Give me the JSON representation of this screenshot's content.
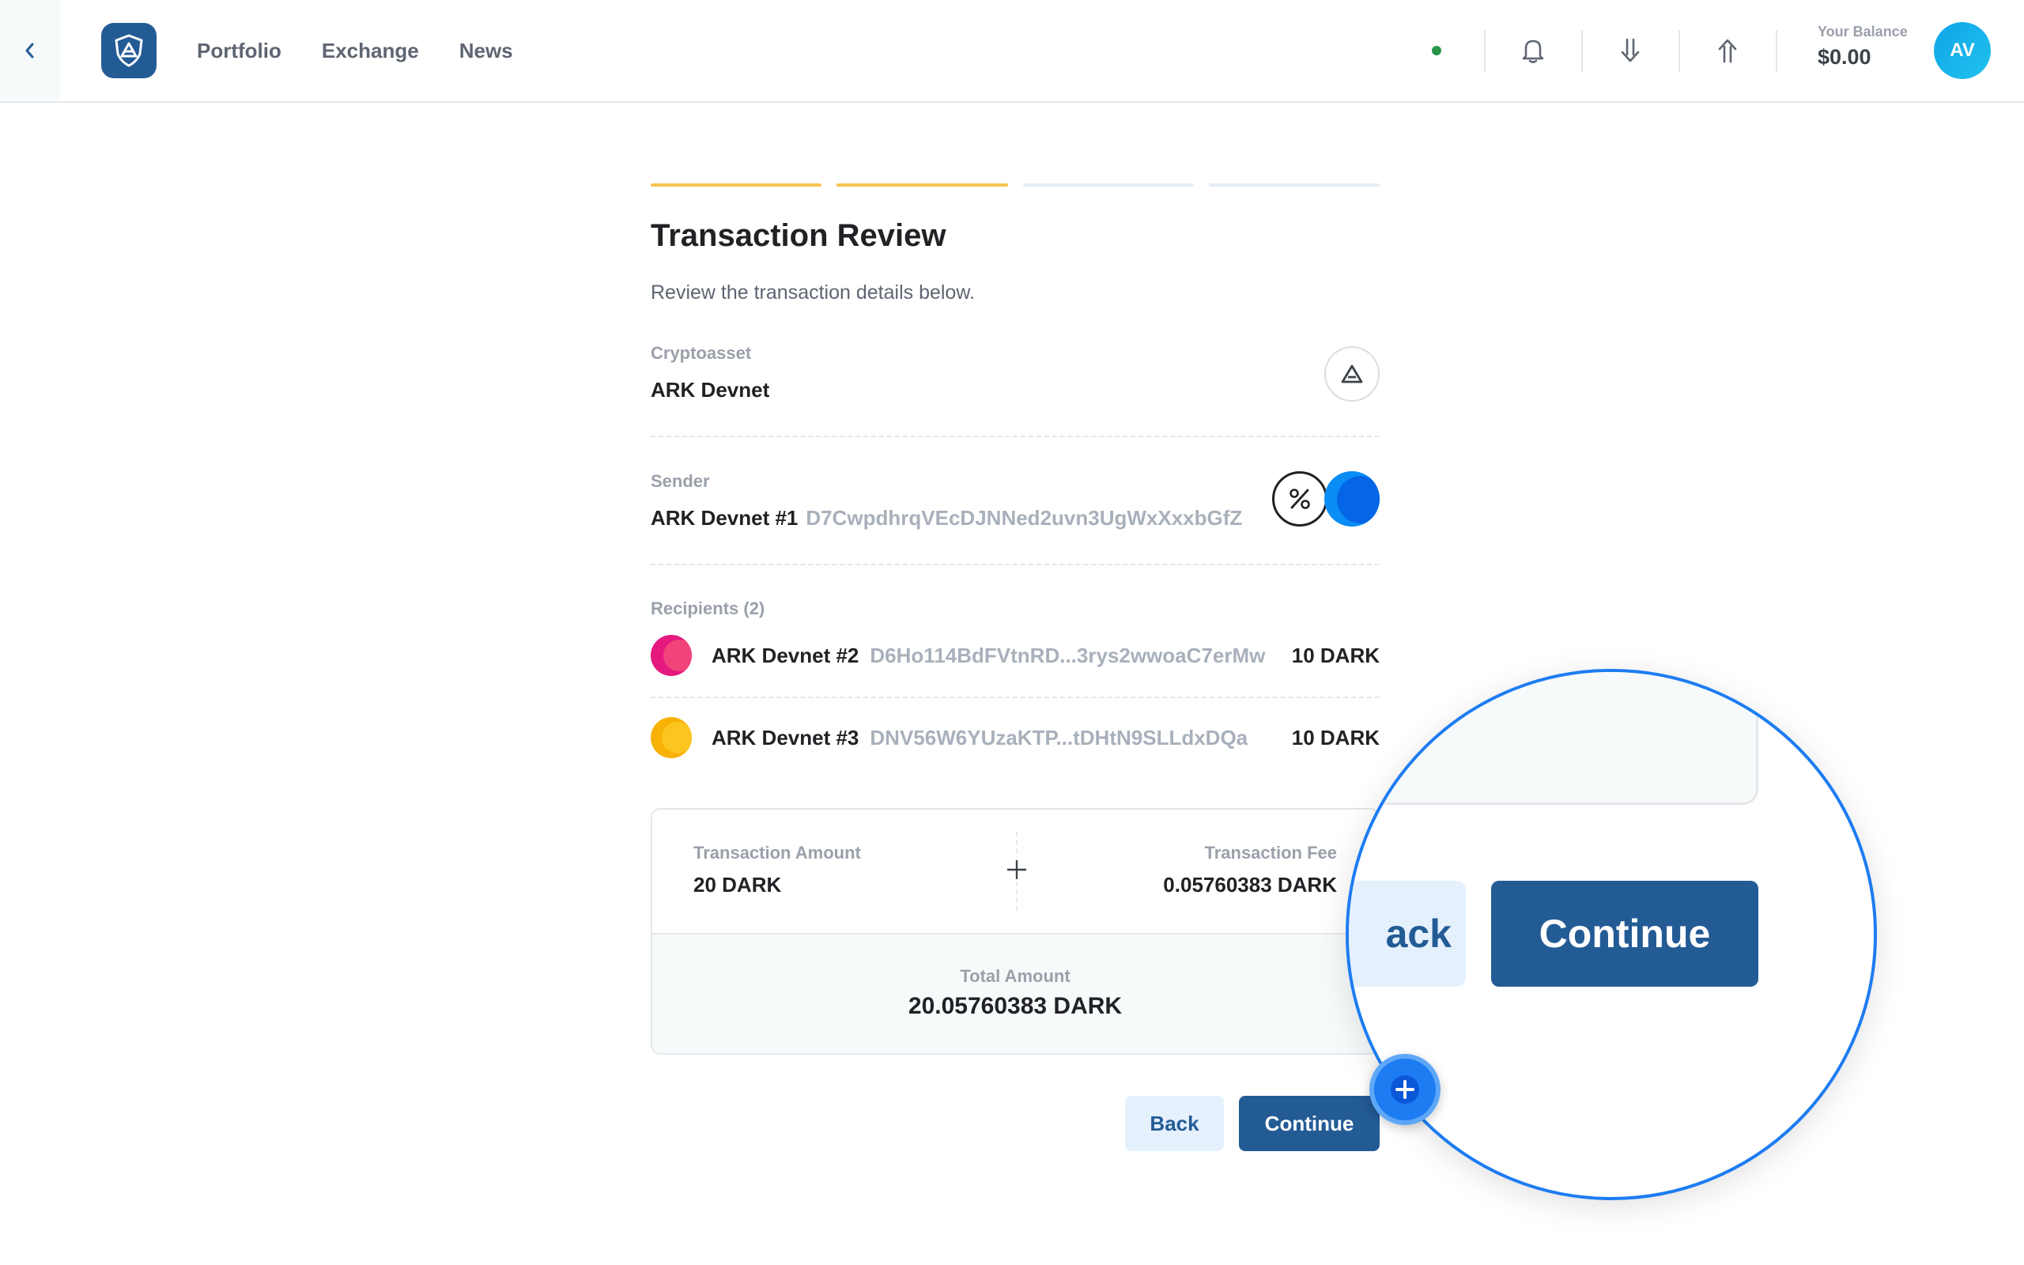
{
  "header": {
    "nav": [
      "Portfolio",
      "Exchange",
      "News"
    ],
    "balance_label": "Your Balance",
    "balance_value": "$0.00",
    "avatar_initials": "AV",
    "status_color": "#289548",
    "icons": [
      "chevron-left-icon",
      "bell-icon",
      "receive-icon",
      "send-icon"
    ]
  },
  "steps": {
    "total": 4,
    "completed": 2
  },
  "review": {
    "title": "Transaction Review",
    "subtitle": "Review the transaction details below.",
    "cryptoasset_label": "Cryptoasset",
    "cryptoasset_value": "ARK Devnet",
    "sender_label": "Sender",
    "sender_name": "ARK Devnet #1",
    "sender_address": "D7CwpdhrqVEcDJNNed2uvn3UgWxXxxbGfZ",
    "recipients_label": "Recipients (2)",
    "recipients": [
      {
        "name": "ARK Devnet #2",
        "address": "D6Ho114BdFVtnRD...3rys2wwoaC7erMw",
        "amount": "10 DARK",
        "color": "#e5197e"
      },
      {
        "name": "ARK Devnet #3",
        "address": "DNV56W6YUzaKTP...tDHtN9SLLdxDQa",
        "amount": "10 DARK",
        "color": "#f8b106"
      }
    ]
  },
  "summary": {
    "amount_label": "Transaction Amount",
    "amount_value": "20 DARK",
    "fee_label": "Transaction Fee",
    "fee_value": "0.05760383 DARK",
    "total_label": "Total Amount",
    "total_value": "20.05760383 DARK"
  },
  "buttons": {
    "back": "Back",
    "continue": "Continue"
  },
  "magnifier": {
    "back_partial": "ack",
    "continue": "Continue"
  },
  "colors": {
    "brand": "#235b95",
    "step_active": "#f7c24e",
    "magnifier_ring": "#1d7cf2"
  }
}
